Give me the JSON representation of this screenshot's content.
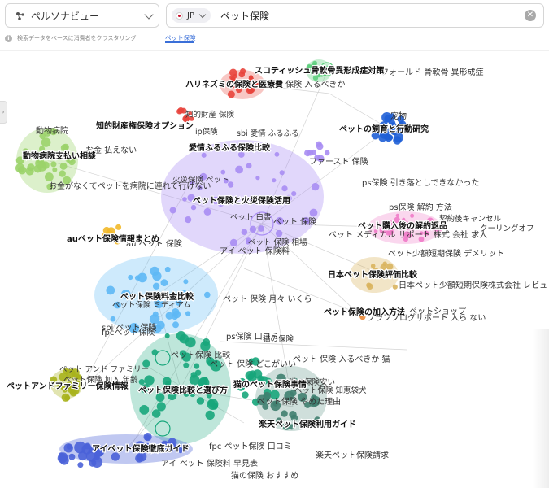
{
  "persona_selector": {
    "label": "ペルソナビュー",
    "icon": "persona-icon"
  },
  "search": {
    "country": "JP",
    "query": "ペット保険",
    "clear_icon": "clear-icon"
  },
  "hint": {
    "text": "検索データをベースに消費者をクラスタリング",
    "icon": "info-icon"
  },
  "query_tag": "ペット保険",
  "side_tab": {
    "icon": "chevron-right-icon"
  },
  "colors": {
    "purple": "#a98df3",
    "green": "#9bd36a",
    "pink": "#f07bc8",
    "blue": "#1f5fd6",
    "teal": "#17a67b",
    "lightblue": "#5eb8f5",
    "olive": "#a8b31c",
    "orange": "#e98a3a",
    "red": "#e8443c",
    "mint": "#5fcf7e",
    "tan": "#d9b45e",
    "darkteal": "#3f7f6f",
    "yellow": "#f2b92a",
    "indigo": "#4a62d8",
    "edge": "#c8c8c8"
  },
  "clusters": [
    {
      "name": "ペット保険と火災保険活用",
      "color": "purple"
    },
    {
      "name": "動物病院支払い相談",
      "color": "green"
    },
    {
      "name": "ペットの飼育と行動研究",
      "color": "blue"
    },
    {
      "name": "ハリネズミの保険と医療費",
      "color": "red"
    },
    {
      "name": "スコティッシュ骨軟骨異形成症対策",
      "color": "mint"
    },
    {
      "name": "知的財産権保険オプション",
      "color": "red"
    },
    {
      "name": "愛情ふるふる保険比較",
      "color": "purple"
    },
    {
      "name": "ペット購入後の解約返品",
      "color": "pink"
    },
    {
      "name": "auペット保険情報まとめ",
      "color": "yellow"
    },
    {
      "name": "日本ペット保険評価比較",
      "color": "tan"
    },
    {
      "name": "ペット保険料金比較",
      "color": "lightblue"
    },
    {
      "name": "ペット保険の加入方法",
      "color": "orange"
    },
    {
      "name": "ペットアンドファミリー保険情報",
      "color": "olive"
    },
    {
      "name": "ペット保険比較と選び方",
      "color": "teal"
    },
    {
      "name": "猫のペット保険事情",
      "color": "teal"
    },
    {
      "name": "楽天ペット保険利用ガイド",
      "color": "darkteal"
    },
    {
      "name": "アイペット保険徹底ガイド",
      "color": "indigo"
    }
  ],
  "keywords": [
    "ユ フォールド 骨軟骨 異形成症",
    "ペット 保険 入るべきか",
    "宠物",
    "知的財産 保険",
    "ip保険",
    "sbi 愛情 ふるふる",
    "ファースト 保険",
    "ps保険 引き落としできなかった",
    "ps保険 解約 方法",
    "契約後キャンセル",
    "クーリングオフ",
    "ペット メディカル サポート 株式 会社 求人",
    "ペット 白書",
    "ペット 保険",
    "ペット 保険 相場",
    "アイ ペット 保険料",
    "ペット少額短期保険 デメリット",
    "日本ペット少額短期保険株式会社 レビュ",
    "ペット 保険 月々 いくら",
    "ペットショップ",
    "ブラフブログサポート 入ら ない",
    "au ペット 保険",
    "sbi ペット保険",
    "fpcペット保険",
    "ps保険 口コミ",
    "猫の保険",
    "ペット 保険 入るべきか 猫",
    "猫の保険安い",
    "ペット保険 やめた理由",
    "楽天ペット保険請求",
    "fpc ペット保険 口コミ",
    "アイ ペット 保険料 早見表",
    "猫の保険 おすすめ",
    "お金がなくてペットを病院に連れて行けない",
    "動物病院",
    "お金 払えない",
    "ペット保険 比較",
    "ペット 保険 どこがいい",
    "ペット アンド ファミリー",
    "ペット保険 加入 年齢",
    "ペット保険 知恵袋犬",
    "ペット保険 ミディアム",
    "火災保険 ペット"
  ]
}
